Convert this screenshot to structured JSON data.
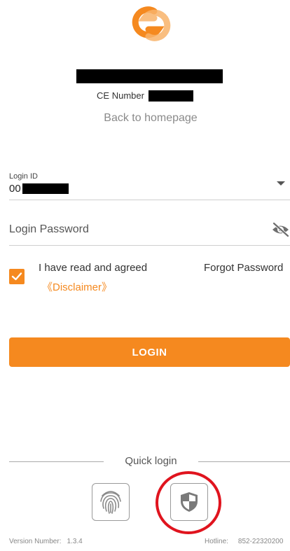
{
  "header": {
    "ce_label": "CE Number",
    "back_link": "Back to homepage"
  },
  "form": {
    "login_id_label": "Login ID",
    "login_id_prefix": "00",
    "password_placeholder": "Login Password",
    "agree_text": "I have read and agreed",
    "disclaimer_link": "《Disclaimer》",
    "forgot_password": "Forgot Password",
    "login_button": "LOGIN"
  },
  "quick_login": {
    "label": "Quick login",
    "icons": [
      "fingerprint-icon",
      "shield-icon"
    ]
  },
  "footer": {
    "version_label": "Version Number:",
    "version_value": "1.3.4",
    "hotline_label": "Hotline:",
    "hotline_value": "852-22320200"
  },
  "colors": {
    "accent": "#f5891f",
    "highlight_circle": "#e0141e"
  }
}
